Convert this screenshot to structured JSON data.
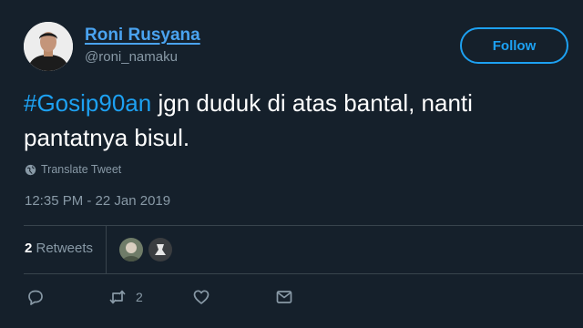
{
  "user": {
    "display_name": "Roni Rusyana",
    "handle": "@roni_namaku",
    "follow_label": "Follow"
  },
  "tweet": {
    "hashtag": "#Gosip90an",
    "text": " jgn duduk di atas bantal, nanti pantatnya bisul.",
    "translate_label": "Translate Tweet",
    "timestamp": "12:35 PM - 22 Jan 2019"
  },
  "stats": {
    "retweet_count": "2",
    "retweet_label": " Retweets"
  },
  "actions": {
    "retweet_count": "2"
  },
  "colors": {
    "background": "#15202b",
    "accent": "#1da1f2",
    "muted": "#8899a6",
    "divider": "#38444d"
  },
  "icons": [
    "reply-icon",
    "retweet-icon",
    "like-icon",
    "message-icon",
    "globe-icon"
  ]
}
